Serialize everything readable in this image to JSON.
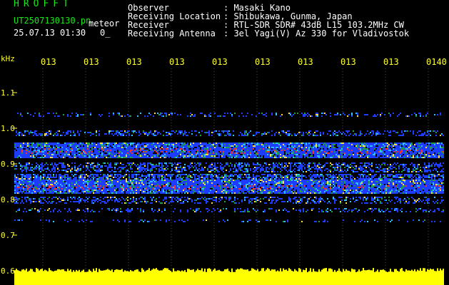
{
  "header": {
    "app_title": "HROFFT",
    "file_name": "UT2507130130.pn",
    "mode": "meteor",
    "datetime": "25.07.13 01:30",
    "extra": "0_",
    "info": [
      {
        "key": "Observer",
        "value": ": Masaki Kano"
      },
      {
        "key": "Receiving Location",
        "value": ": Shibukawa, Gunma, Japan"
      },
      {
        "key": "Receiver",
        "value": ": RTL-SDR SDR# 43dB L15 103.2MHz CW"
      },
      {
        "key": "Receiving Antenna",
        "value": ": 3el Yagi(V) Az 330 for Vladivostok"
      }
    ]
  },
  "axis": {
    "y_unit": "kHz",
    "x_ticks": [
      "013",
      "013",
      "013",
      "013",
      "013",
      "013",
      "013",
      "013",
      "013",
      "0140"
    ],
    "y_ticks": [
      "1.1",
      "1.0",
      "0.9",
      "0.8",
      "0.7",
      "0.6"
    ]
  },
  "colors": {
    "background": "#000000",
    "header_green": "#19e619",
    "axis_yellow": "#ffff33",
    "signal_blue": "#1e3cff",
    "signal_red": "#ff3020",
    "audio_level": "#ffff00"
  }
}
